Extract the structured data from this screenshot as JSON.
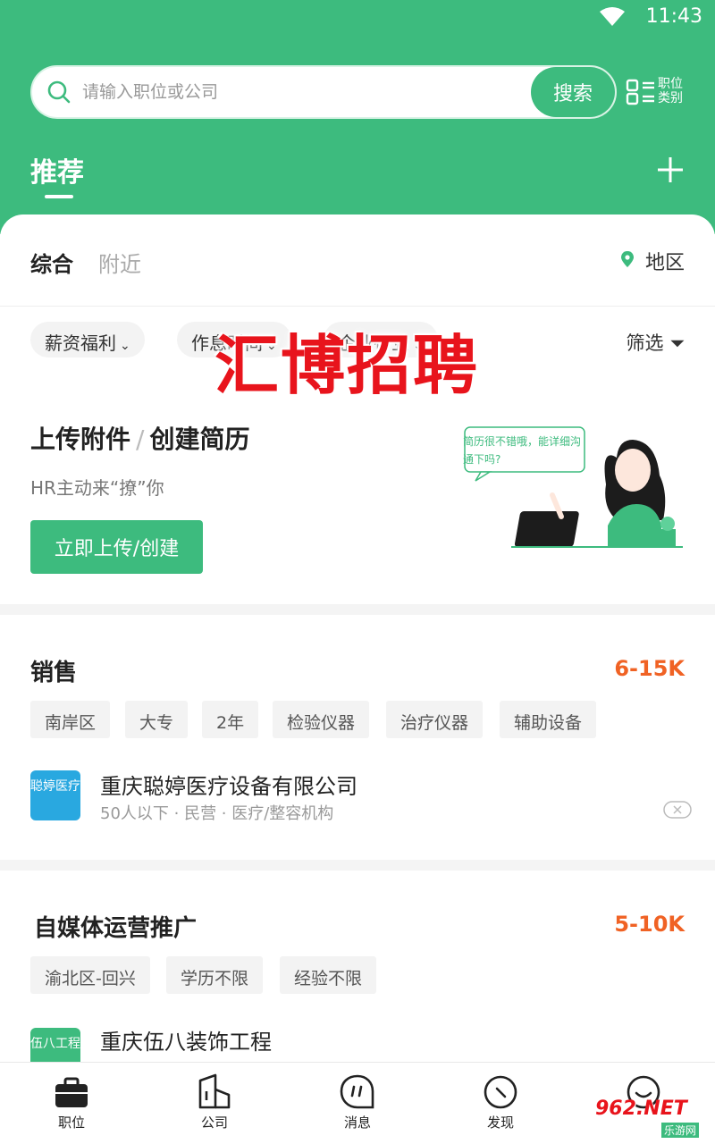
{
  "status": {
    "time": "11:43"
  },
  "search": {
    "placeholder": "请输入职位或公司",
    "button": "搜索"
  },
  "category": {
    "label": "职位类别"
  },
  "tabs": {
    "active": "推荐"
  },
  "subtabs": {
    "comprehensive": "综合",
    "nearby": "附近",
    "region": "地区"
  },
  "filters": {
    "chips": [
      "薪资福利",
      "作息时间",
      "企业行业"
    ],
    "filter_label": "筛选"
  },
  "upload": {
    "title_a": "上传附件",
    "slash": "/",
    "title_b": "创建简历",
    "subtitle": "HR主动来“撩”你",
    "button": "立即上传/创建",
    "bubble": "简历很不错哦，能详细沟通下吗?"
  },
  "watermark": "汇博招聘",
  "jobs": [
    {
      "title": "销售",
      "salary": "6-15K",
      "tags": [
        "南岸区",
        "大专",
        "2年",
        "检验仪器",
        "治疗仪器",
        "辅助设备"
      ],
      "logo_text": "聪婷医疗",
      "logo_color": "#29a8e0",
      "company": "重庆聪婷医疗设备有限公司",
      "meta": "50人以下 · 民营 · 医疗/整容机构"
    },
    {
      "title": "自媒体运营推广",
      "salary": "5-10K",
      "tags": [
        "渝北区-回兴",
        "学历不限",
        "经验不限"
      ],
      "logo_text": "伍八工程",
      "logo_color": "#3dbb7e",
      "company": "重庆伍八装饰工程",
      "meta": ""
    }
  ],
  "nav": [
    {
      "label": "职位",
      "icon": "briefcase-icon"
    },
    {
      "label": "公司",
      "icon": "building-icon"
    },
    {
      "label": "消息",
      "icon": "message-icon"
    },
    {
      "label": "发现",
      "icon": "compass-icon"
    },
    {
      "label": "",
      "icon": "smile-icon"
    }
  ],
  "badge": {
    "text": "962.NET",
    "sub": "乐游网"
  },
  "colors": {
    "brand": "#3dbb7e",
    "salary": "#f06224"
  }
}
